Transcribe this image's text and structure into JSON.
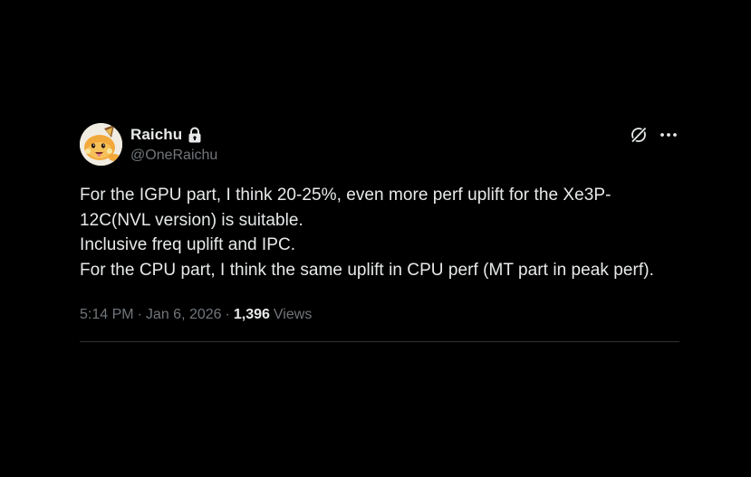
{
  "tweet": {
    "author": {
      "display_name": "Raichu",
      "handle": "@OneRaichu",
      "protected_icon": "lock-icon",
      "avatar_icon": "raichu-avatar"
    },
    "actions": {
      "grok_icon": "grok-icon",
      "more_icon": "more-options-icon"
    },
    "lines": [
      "For the IGPU part, I think 20-25%, even more perf uplift for the Xe3P-12C(NVL version) is suitable.",
      "Inclusive freq uplift and IPC.",
      "For the CPU part, I think the same uplift in CPU perf (MT part in peak perf)."
    ],
    "time": "5:14 PM",
    "separator": "·",
    "date": "Jan 6, 2026",
    "views_count": "1,396",
    "views_label": "Views"
  },
  "colors": {
    "background": "#000000",
    "primary_text": "#e7e9ea",
    "secondary_text": "#71767b",
    "divider": "#2f3336"
  }
}
